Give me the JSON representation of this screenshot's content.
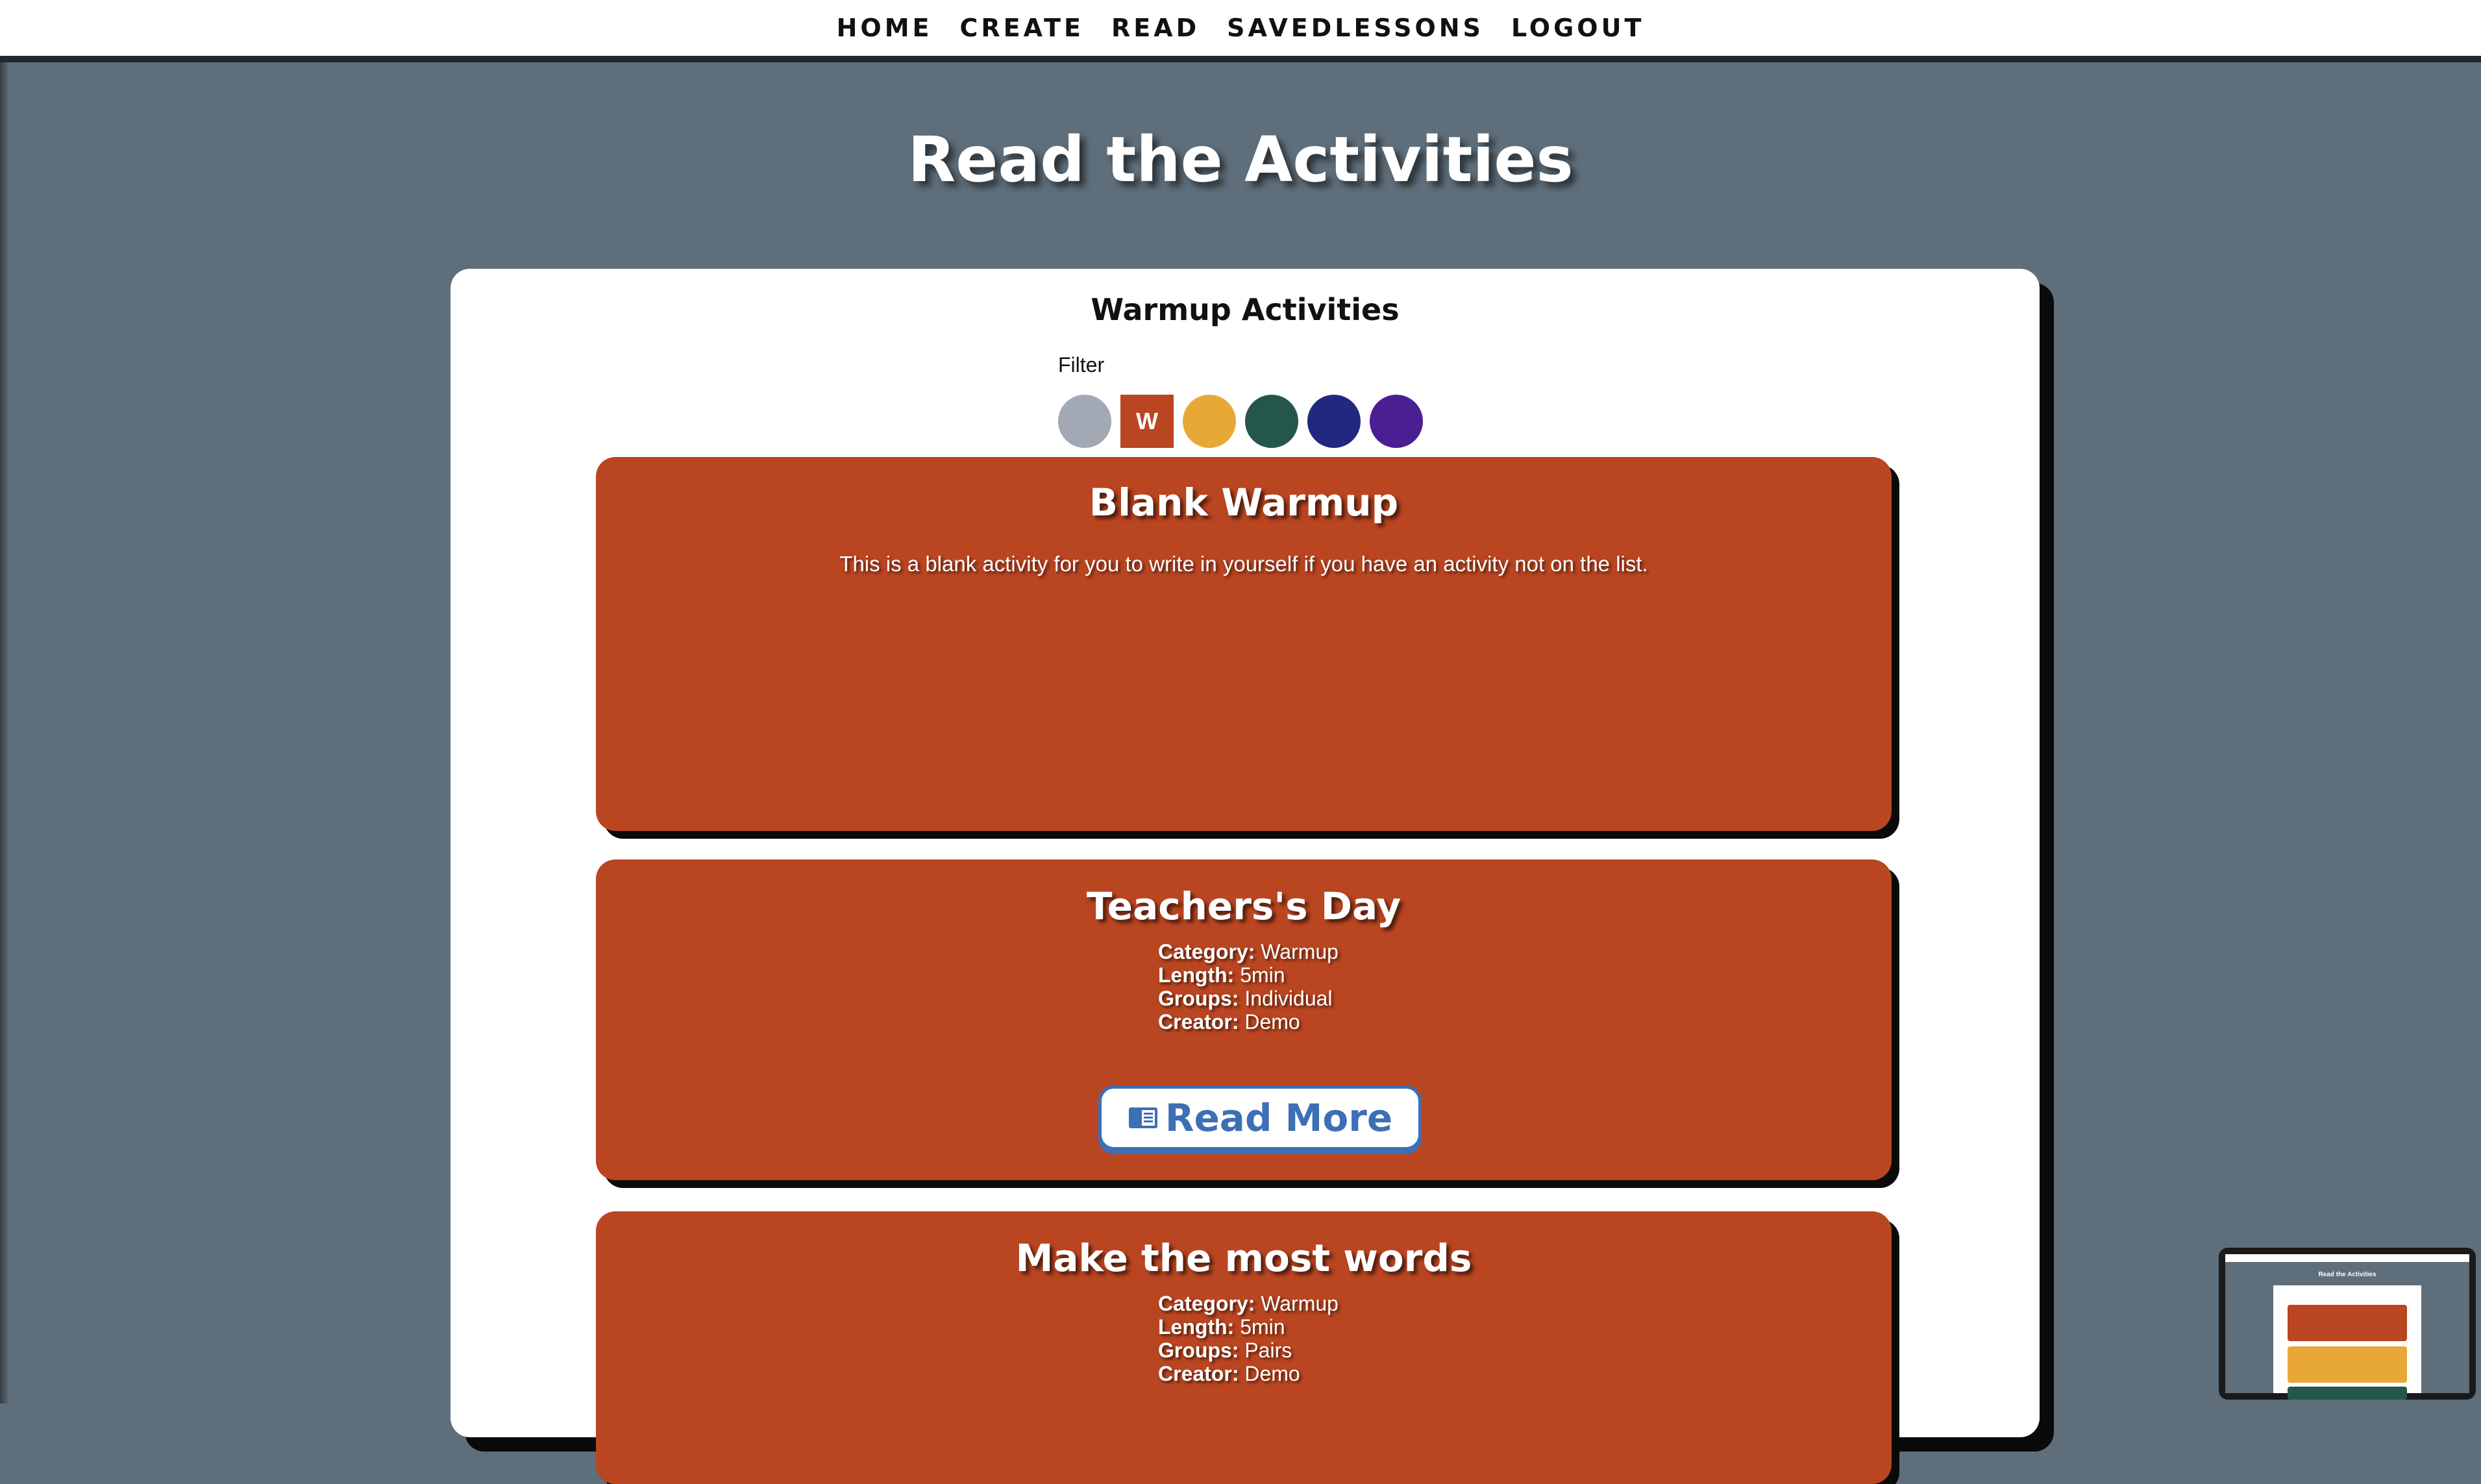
{
  "nav": {
    "items": [
      {
        "label": "HOME"
      },
      {
        "label": "CREATE"
      },
      {
        "label": "READ"
      },
      {
        "label": "SAVEDLESSONS"
      },
      {
        "label": "LOGOUT"
      }
    ]
  },
  "page": {
    "title": "Read the Activities"
  },
  "panel": {
    "section_title": "Warmup Activities",
    "filter_label": "Filter",
    "filters": [
      {
        "name": "all",
        "color": "#a2a9b5",
        "label": ""
      },
      {
        "name": "warmup",
        "color": "#ba4521",
        "label": "W",
        "active": true
      },
      {
        "name": "yellow",
        "color": "#e8a838",
        "label": ""
      },
      {
        "name": "green",
        "color": "#24574a",
        "label": ""
      },
      {
        "name": "blue",
        "color": "#21297f",
        "label": ""
      },
      {
        "name": "purple",
        "color": "#4b1f94",
        "label": ""
      }
    ]
  },
  "cards": [
    {
      "title": "Blank Warmup",
      "description": "This is a blank activity for you to write in yourself if you have an activity not on the list."
    },
    {
      "title": "Teachers's Day",
      "category_label": "Category:",
      "category": "Warmup",
      "length_label": "Length:",
      "length": "5min",
      "groups_label": "Groups:",
      "groups": "Individual",
      "creator_label": "Creator:",
      "creator": "Demo",
      "button": "Read More"
    },
    {
      "title": "Make the most words",
      "category_label": "Category:",
      "category": "Warmup",
      "length_label": "Length:",
      "length": "5min",
      "groups_label": "Groups:",
      "groups": "Pairs",
      "creator_label": "Creator:",
      "creator": "Demo"
    }
  ],
  "minimap": {
    "title": "Read the Activities"
  },
  "colors": {
    "background": "#5e6e7a",
    "card": "#ba4521",
    "accent_button": "#3d6fb5"
  }
}
